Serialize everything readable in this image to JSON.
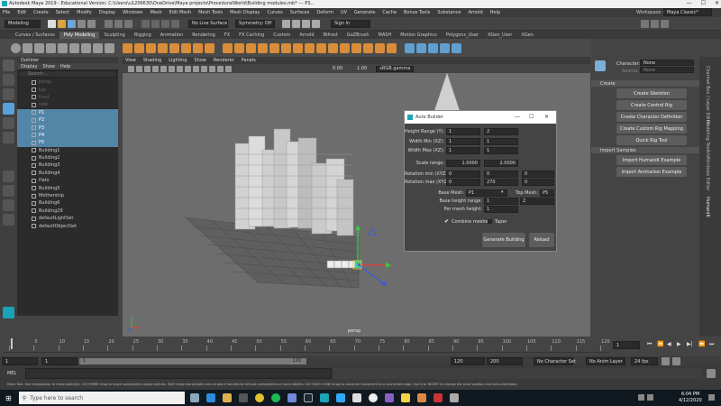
{
  "window": {
    "title": "Autodesk Maya 2019 - Educational Version: C:\\Users\\u1206630\\OneDrive\\Maya projects\\ProceduralWorld\\Building modules.mb* --- PS...",
    "controls": [
      "—",
      "☐",
      "✕"
    ]
  },
  "menubar": {
    "items": [
      "File",
      "Edit",
      "Create",
      "Select",
      "Modify",
      "Display",
      "Windows",
      "Mesh",
      "Edit Mesh",
      "Mesh Tools",
      "Mesh Display",
      "Curves",
      "Surfaces",
      "Deform",
      "UV",
      "Generate",
      "Cache",
      "Bonus Tools",
      "Substance",
      "Arnold",
      "Help"
    ],
    "workspace_label": "Workspace :",
    "workspace_value": "Maya Classic*"
  },
  "statusline": {
    "mode": "Modeling",
    "live_surface": "No Live Surface",
    "symmetry": "Symmetry: Off",
    "sign_in": "Sign In"
  },
  "shelf_tabs": [
    "Curves / Surfaces",
    "Poly Modeling",
    "Sculpting",
    "Rigging",
    "Animation",
    "Rendering",
    "FX",
    "FX Caching",
    "Custom",
    "Arnold",
    "Bifrost",
    "GoZBrush",
    "MASH",
    "Motion Graphics",
    "Polygons_User",
    "XGen_User",
    "XGen"
  ],
  "active_shelf_tab": "Poly Modeling",
  "outliner": {
    "title": "Outliner",
    "menu": [
      "Display",
      "Show",
      "Help"
    ],
    "search_placeholder": "Search...",
    "items": [
      {
        "label": "persp",
        "state": "dim"
      },
      {
        "label": "top",
        "state": "dim"
      },
      {
        "label": "front",
        "state": "dim"
      },
      {
        "label": "side",
        "state": "dim"
      },
      {
        "label": "P1",
        "state": "sel"
      },
      {
        "label": "P2",
        "state": "sel"
      },
      {
        "label": "P3",
        "state": "sel"
      },
      {
        "label": "P4",
        "state": "sel"
      },
      {
        "label": "P5",
        "state": "sel"
      },
      {
        "label": "Building1",
        "state": ""
      },
      {
        "label": "Building2",
        "state": ""
      },
      {
        "label": "Building3",
        "state": ""
      },
      {
        "label": "Building4",
        "state": ""
      },
      {
        "label": "Hats",
        "state": ""
      },
      {
        "label": "Building5",
        "state": ""
      },
      {
        "label": "Mothership",
        "state": ""
      },
      {
        "label": "Building6",
        "state": ""
      },
      {
        "label": "Building29",
        "state": ""
      },
      {
        "label": "defaultLightSet",
        "state": ""
      },
      {
        "label": "defaultObjectSet",
        "state": ""
      }
    ]
  },
  "viewport": {
    "menu": [
      "View",
      "Shading",
      "Lighting",
      "Show",
      "Renderer",
      "Panels"
    ],
    "gamma_label": "sRGB gamma",
    "value_a": "0.00",
    "value_b": "1.00",
    "camera_label": "persp"
  },
  "right_panel": {
    "character_label": "Character:",
    "character_value": "None",
    "source_label": "Source:",
    "source_value": "None",
    "create_header": "Create",
    "create_buttons": [
      "Create Skeleton",
      "Create Control Rig",
      "Create Character Definition",
      "Create Custom Rig Mapping",
      "Quick Rig Tool"
    ],
    "import_header": "Import Samples",
    "import_buttons": [
      "Import HumanIK Example",
      "Import Animation Example"
    ],
    "side_tabs": [
      "Channel Box / Layer Editor",
      "Modeling Toolkit",
      "Attribute Editor",
      "HumanIK"
    ]
  },
  "dialog": {
    "title": "Auto Builder",
    "height_range_label": "Height Range (Y):",
    "height_min": "1",
    "height_max": "2",
    "width_min_label": "Width Min (XZ):",
    "width_min_a": "1",
    "width_min_b": "1",
    "width_max_label": "Width Max (XZ):",
    "width_max_a": "1",
    "width_max_b": "1",
    "scale_label": "Scale range:",
    "scale_min": "1.0000",
    "scale_max": "2.0000",
    "rot_min_label": "Rotation min (XYZ):",
    "rot_min": [
      "0",
      "0",
      "0"
    ],
    "rot_max_label": "Rotation max (XYZ):",
    "rot_max": [
      "0",
      "270",
      "0"
    ],
    "base_mesh_label": "Base Mesh:",
    "base_mesh_value": "P1",
    "top_mesh_label": "Top Mesh:",
    "top_mesh_value": "P5",
    "base_height_label": "Base height range:",
    "base_height_a": "1",
    "base_height_b": "2",
    "per_mesh_label": "Per mesh height:",
    "per_mesh_value": "1",
    "combine_label": "Combine meshes",
    "combine_checked": true,
    "taper_label": "Taper",
    "taper_checked": false,
    "generate_button": "Generate Building",
    "reload_button": "Reload"
  },
  "timeline": {
    "ticks": [
      "1",
      "5",
      "10",
      "15",
      "20",
      "25",
      "30",
      "35",
      "40",
      "45",
      "50",
      "55",
      "60",
      "65",
      "70",
      "75",
      "80",
      "85",
      "90",
      "95",
      "100",
      "105",
      "110",
      "115",
      "120"
    ],
    "current_frame": "1"
  },
  "range": {
    "start": "1",
    "inner_start": "1",
    "slider_label_start": "1",
    "slider_label_end": "120",
    "inner_end": "120",
    "end": "200",
    "character_set": "No Character Set",
    "anim_layer": "No Anim Layer",
    "fps": "24 fps"
  },
  "mel": {
    "label": "MEL"
  },
  "help_line": "Move Tool: Use manipulator to move object(s). Ctrl+MMB+drag to move components along normals. Shift+drag manipulator axis or plane handles to extrude components or clone objects. Ctrl+Shift+LMB+drag to constrain movement to a connected edge. Use D or INSERT to change the pivot position and axis orientation.",
  "taskbar": {
    "search_placeholder": "Type here to search",
    "time": "6:04 PM",
    "date": "4/12/2020"
  }
}
